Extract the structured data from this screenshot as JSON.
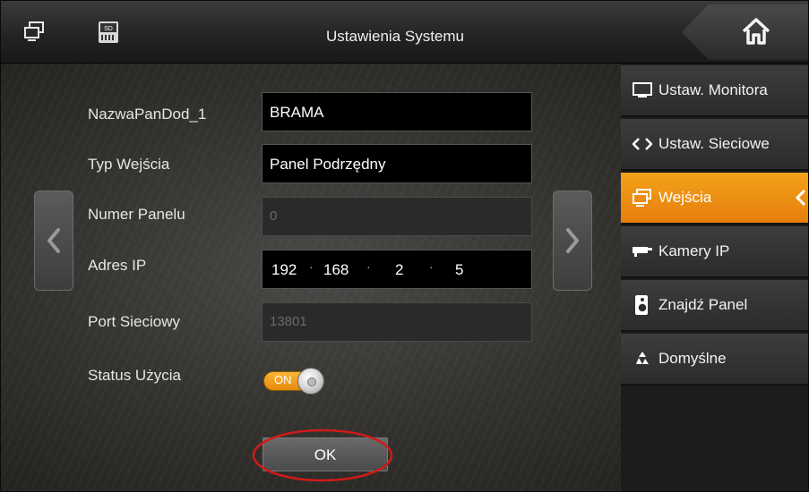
{
  "header": {
    "title": "Ustawienia Systemu",
    "left_icons": [
      "monitor-stack-icon",
      "sd-card-icon"
    ],
    "home_icon": "home-icon"
  },
  "sidebar": {
    "items": [
      {
        "label": "Ustaw. Monitora",
        "icon": "monitor-icon",
        "active": false
      },
      {
        "label": "Ustaw. Sieciowe",
        "icon": "network-arrows-icon",
        "active": false
      },
      {
        "label": "Wejścia",
        "icon": "door-station-icon",
        "active": true
      },
      {
        "label": "Kamery IP",
        "icon": "ip-camera-icon",
        "active": false
      },
      {
        "label": "Znajdź Panel",
        "icon": "search-panel-icon",
        "active": false
      },
      {
        "label": "Domyślne",
        "icon": "recycle-icon",
        "active": false
      }
    ],
    "active_color": "#f08c12"
  },
  "form": {
    "name_label": "NazwaPanDod_1",
    "name_value": "BRAMA",
    "type_label": "Typ Wejścia",
    "type_value": "Panel Podrzędny",
    "panel_number_label": "Numer Panelu",
    "panel_number_value": "0",
    "ip_label": "Adres IP",
    "ip": [
      "192",
      "168",
      "2",
      "5"
    ],
    "port_label": "Port Sieciowy",
    "port_value": "13801",
    "status_label": "Status Użycia",
    "status_toggle_text": "ON",
    "ok_label": "OK"
  },
  "annotation": {
    "color": "#d11a1a",
    "target": "ok-button"
  }
}
